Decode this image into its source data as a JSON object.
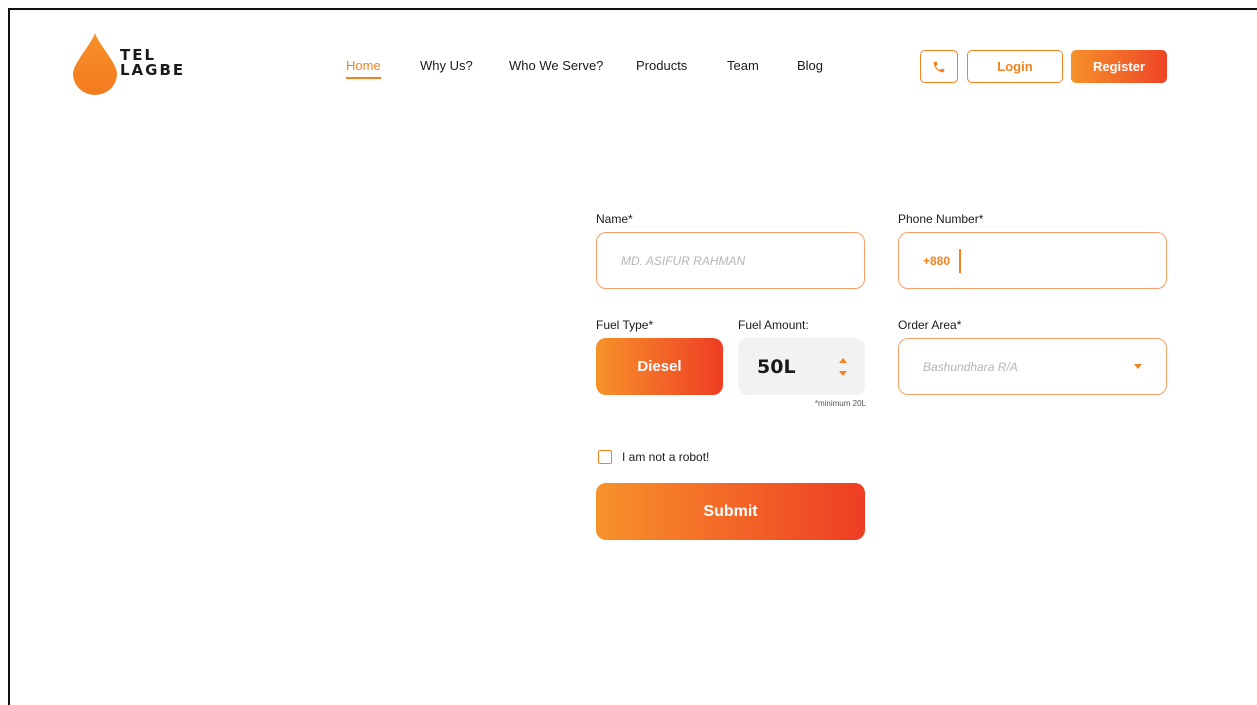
{
  "brand": {
    "line1": "TEL",
    "line2": "LAGBE",
    "accent_color": "#f5821f",
    "gradient_end_color": "#ee3d24"
  },
  "nav": {
    "items": [
      {
        "label": "Home",
        "active": true
      },
      {
        "label": "Why Us?",
        "active": false
      },
      {
        "label": "Who We Serve?",
        "active": false
      },
      {
        "label": "Products",
        "active": false
      },
      {
        "label": "Team",
        "active": false
      },
      {
        "label": "Blog",
        "active": false
      }
    ]
  },
  "header_actions": {
    "phone_icon": "phone-icon",
    "login_label": "Login",
    "register_label": "Register"
  },
  "form": {
    "name": {
      "label": "Name*",
      "placeholder": "MD. ASIFUR RAHMAN",
      "value": ""
    },
    "phone": {
      "label": "Phone Number*",
      "prefix": "+880",
      "value": ""
    },
    "fuel_type": {
      "label": "Fuel Type*",
      "value": "Diesel"
    },
    "fuel_amount": {
      "label": "Fuel Amount:",
      "value": "50L",
      "note": "*minimum 20L"
    },
    "order_area": {
      "label": "Order Area*",
      "placeholder": "Bashundhara R/A"
    },
    "robot_check": {
      "label": "I am not a robot!",
      "checked": false
    },
    "submit_label": "Submit"
  }
}
